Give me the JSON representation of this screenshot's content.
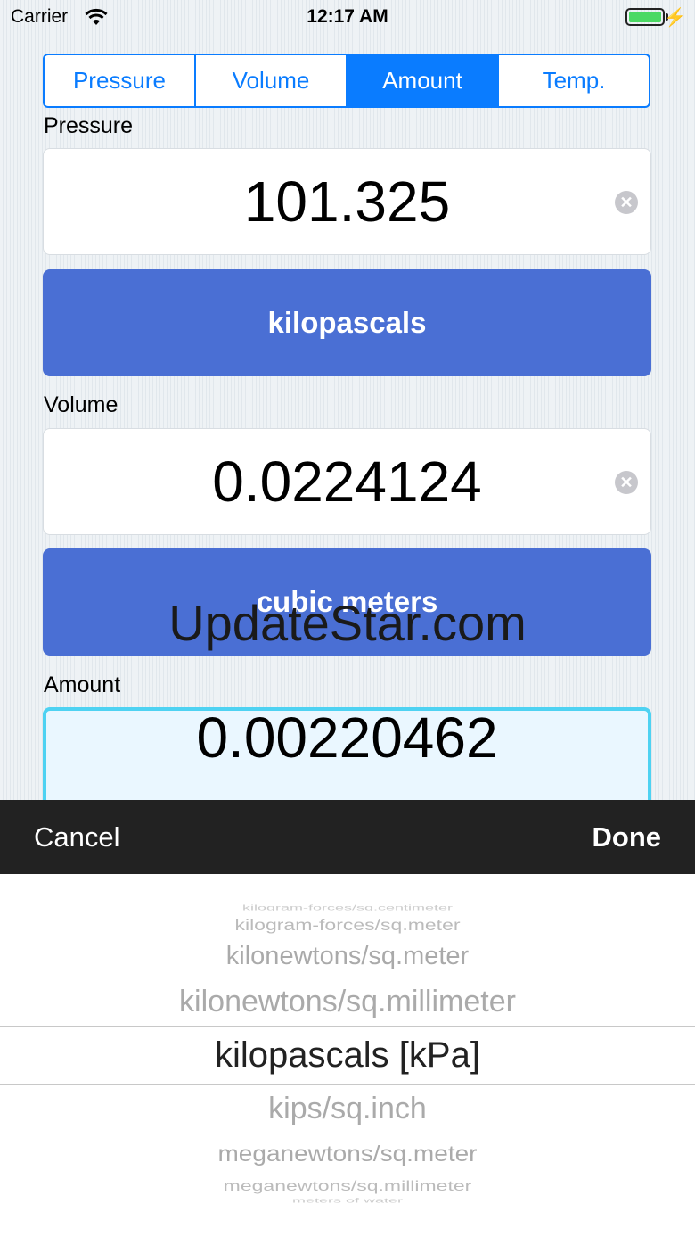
{
  "status_bar": {
    "carrier": "Carrier",
    "time": "12:17 AM"
  },
  "tabs": [
    {
      "label": "Pressure",
      "active": false
    },
    {
      "label": "Volume",
      "active": false
    },
    {
      "label": "Amount",
      "active": true
    },
    {
      "label": "Temp.",
      "active": false
    }
  ],
  "pressure": {
    "label": "Pressure",
    "value": "101.325",
    "unit": "kilopascals"
  },
  "volume": {
    "label": "Volume",
    "value": "0.0224124",
    "unit": "cubic meters"
  },
  "amount": {
    "label": "Amount",
    "value": "0.00220462"
  },
  "watermark": "UpdateStar.com",
  "toolbar": {
    "cancel": "Cancel",
    "done": "Done"
  },
  "picker": {
    "items": [
      "kilogram-forces/sq.centimeter",
      "kilogram-forces/sq.meter",
      "kilonewtons/sq.meter",
      "kilonewtons/sq.millimeter",
      "kilopascals [kPa]",
      "kips/sq.inch",
      "meganewtons/sq.meter",
      "meganewtons/sq.millimeter",
      "meters of water"
    ],
    "selected": "kilopascals [kPa]"
  },
  "colors": {
    "accent": "#0a7cff",
    "unit_button": "#4a6fd4",
    "active_border": "#4ed2f2"
  }
}
